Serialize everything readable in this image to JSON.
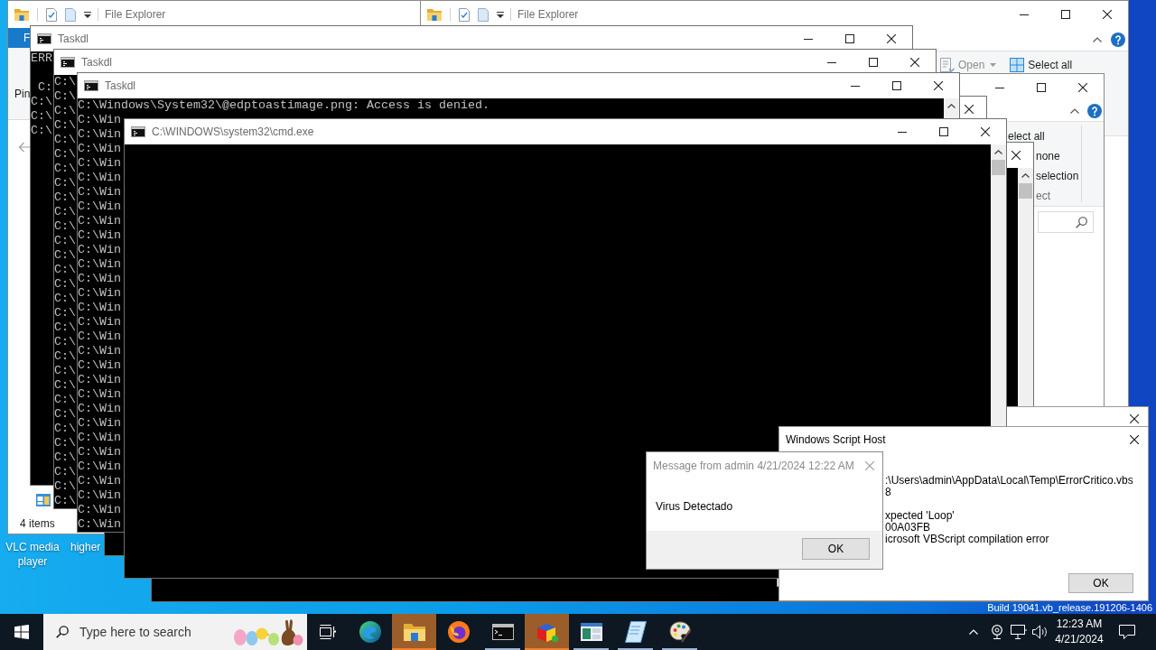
{
  "desktop": {
    "icons": [
      {
        "label": "VLC media player"
      },
      {
        "label": "higher"
      }
    ],
    "build_info": "Build 19041.vb_release.191206-1406"
  },
  "explorer_left": {
    "title": "File Explorer",
    "file_tab": "F",
    "ribbon_label": "Pin",
    "status_bar": "4 items"
  },
  "explorer_right": {
    "title": "File Explorer",
    "ribbon_buttons": [
      {
        "kind": "open",
        "label": "Open",
        "disabled": true
      },
      {
        "kind": "select-all",
        "label": "Select all",
        "disabled": false
      }
    ]
  },
  "explorer_small": {
    "ribbon_items": [
      {
        "kind": "command",
        "label": "elect all"
      },
      {
        "kind": "command",
        "label": "none"
      },
      {
        "kind": "command",
        "label": "selection"
      },
      {
        "kind": "group-label",
        "label": "ect"
      }
    ]
  },
  "consoles": [
    {
      "title": "Taskdl",
      "blocks": [
        [
          "ERR"
        ],
        [
          " C:",
          "C:\\",
          "C:\\",
          "C:\\"
        ]
      ]
    },
    {
      "title": "Taskdl",
      "blocks": [
        [
          "C:\\",
          "C:\\",
          "C:\\",
          "C:\\",
          "C:\\",
          "C:\\",
          "C:\\",
          "C:\\",
          "C:\\",
          "C:\\",
          "C:\\",
          "C:\\",
          "C:\\",
          "C:\\",
          "C:\\",
          "C:\\",
          "C:\\",
          "C:\\",
          "C:\\",
          "C:\\",
          "C:\\",
          "C:\\",
          "C:\\",
          "C:\\",
          "C:\\",
          "C:\\",
          "C:\\",
          "C:\\",
          "C:\\",
          "C:\\"
        ]
      ]
    },
    {
      "title": "Taskdl",
      "blocks": [
        [
          "C:\\Windows\\System32\\@edptoastimage.png: Access is denied.",
          "C:\\Win",
          "C:\\Win",
          "C:\\Win",
          "C:\\Win",
          "C:\\Win",
          "C:\\Win",
          "C:\\Win",
          "C:\\Win",
          "C:\\Win",
          "C:\\Win",
          "C:\\Win",
          "C:\\Win",
          "C:\\Win",
          "C:\\Win",
          "C:\\Win",
          "C:\\Win",
          "C:\\Win",
          "C:\\Win",
          "C:\\Win",
          "C:\\Win",
          "C:\\Win",
          "C:\\Win",
          "C:\\Win",
          "C:\\Win",
          "C:\\Win",
          "C:\\Win",
          "C:\\Win",
          "C:\\Win",
          "C:\\Win"
        ]
      ]
    }
  ],
  "cmd_window": {
    "title": "C:\\WINDOWS\\system32\\cmd.exe"
  },
  "script_host_dialog": {
    "title": "Windows Script Host",
    "blocks": [
      [
        ":\\Users\\admin\\AppData\\Local\\Temp\\ErrorCritico.vbs",
        "8"
      ],
      [
        "xpected 'Loop'",
        "00A03FB",
        "icrosoft VBScript compilation error"
      ]
    ],
    "button": "OK"
  },
  "message_dialog": {
    "title": "Message from admin 4/21/2024 12:22 AM",
    "message": "Virus Detectado",
    "button": "OK"
  },
  "taskbar": {
    "search": {
      "placeholder": "Type here to search"
    },
    "apps": [
      {
        "kind": "task-view",
        "active": false,
        "running": false
      },
      {
        "kind": "edge",
        "active": false,
        "running": false
      },
      {
        "kind": "folder",
        "active": true,
        "running": true
      },
      {
        "kind": "firefox",
        "active": false,
        "running": false
      },
      {
        "kind": "terminal",
        "active": false,
        "running": true
      },
      {
        "kind": "cube",
        "active": true,
        "running": true
      },
      {
        "kind": "window",
        "active": false,
        "running": true
      },
      {
        "kind": "notepad",
        "active": false,
        "running": true
      },
      {
        "kind": "paint",
        "active": false,
        "running": true
      }
    ],
    "clock": {
      "time": "12:23 AM",
      "date": "4/21/2024"
    }
  }
}
